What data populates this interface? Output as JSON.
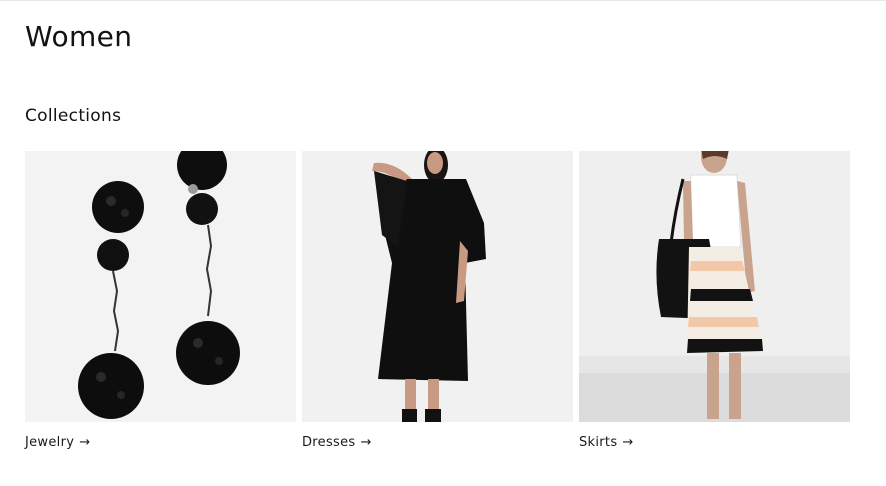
{
  "page": {
    "title": "Women"
  },
  "collections": {
    "heading": "Collections",
    "items": [
      {
        "label": "Jewelry",
        "image": "black-beaded-drop-earrings",
        "arrow": "arrow-right-icon"
      },
      {
        "label": "Dresses",
        "image": "woman-in-black-dress",
        "arrow": "arrow-right-icon"
      },
      {
        "label": "Skirts",
        "image": "woman-in-striped-skirt-with-black-bag",
        "arrow": "arrow-right-icon"
      }
    ]
  }
}
